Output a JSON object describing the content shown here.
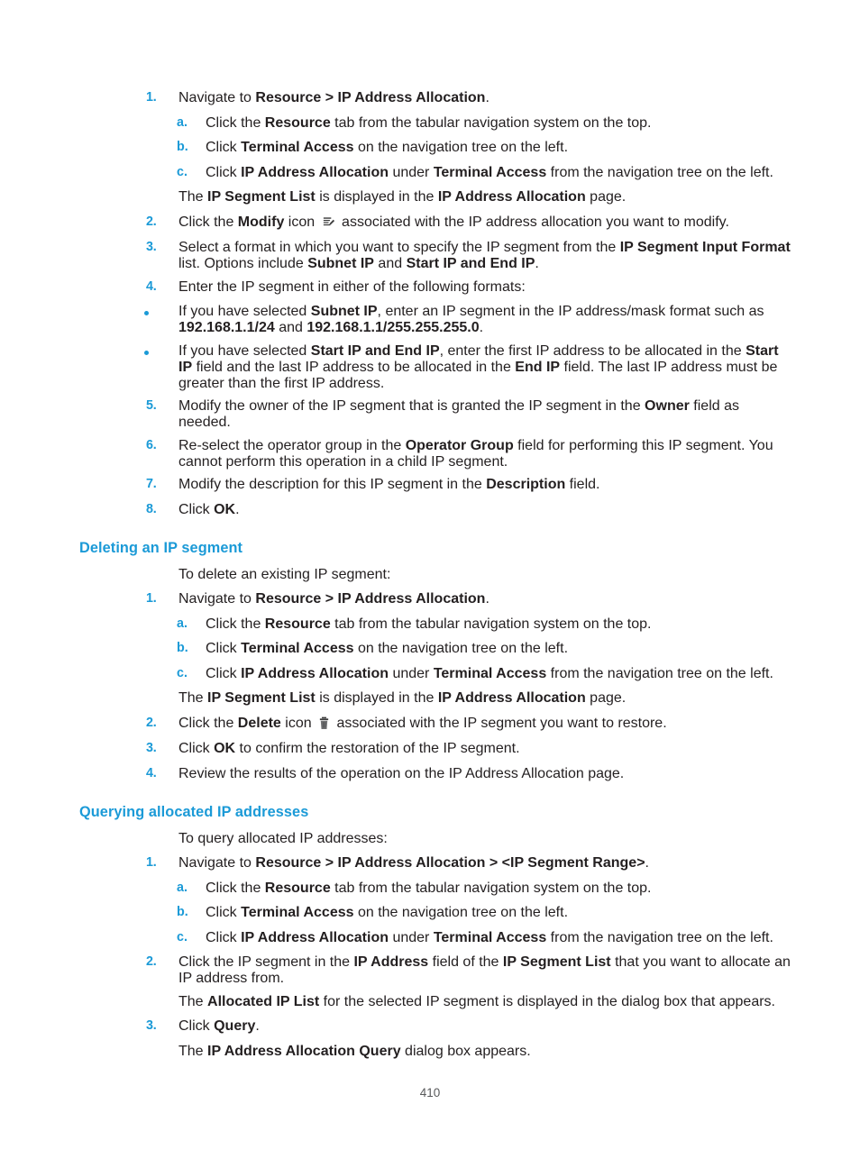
{
  "document": {
    "page_number": "410",
    "accent_color": "#1b9ad7",
    "text_color": "#231f20"
  },
  "sections": [
    {
      "id": "modify-steps",
      "heading": null,
      "items": [
        {
          "type": "numbered",
          "marker": "1.",
          "parts": [
            {
              "t": "Navigate to ",
              "b": false
            },
            {
              "t": "Resource > IP Address Allocation",
              "b": true
            },
            {
              "t": ".",
              "b": false
            }
          ]
        },
        {
          "type": "lettered",
          "marker": "a.",
          "parts": [
            {
              "t": "Click the ",
              "b": false
            },
            {
              "t": "Resource",
              "b": true
            },
            {
              "t": " tab from the tabular navigation system on the top.",
              "b": false
            }
          ]
        },
        {
          "type": "lettered",
          "marker": "b.",
          "parts": [
            {
              "t": "Click ",
              "b": false
            },
            {
              "t": "Terminal Access",
              "b": true
            },
            {
              "t": " on the navigation tree on the left.",
              "b": false
            }
          ]
        },
        {
          "type": "lettered",
          "marker": "c.",
          "parts": [
            {
              "t": "Click ",
              "b": false
            },
            {
              "t": "IP Address Allocation",
              "b": true
            },
            {
              "t": " under ",
              "b": false
            },
            {
              "t": "Terminal Access",
              "b": true
            },
            {
              "t": " from the navigation tree on the left.",
              "b": false
            }
          ]
        },
        {
          "type": "continuation-sub",
          "parts": [
            {
              "t": "The ",
              "b": false
            },
            {
              "t": "IP Segment List",
              "b": true
            },
            {
              "t": " is displayed in the ",
              "b": false
            },
            {
              "t": "IP Address Allocation",
              "b": true
            },
            {
              "t": " page.",
              "b": false
            }
          ]
        },
        {
          "type": "numbered",
          "marker": "2.",
          "icon": "modify-icon",
          "parts": [
            {
              "t": "Click the ",
              "b": false
            },
            {
              "t": "Modify",
              "b": true
            },
            {
              "t": " icon ",
              "b": false
            },
            {
              "t": "@ICON@",
              "b": false
            },
            {
              "t": " associated with the IP address allocation you want to modify.",
              "b": false
            }
          ]
        },
        {
          "type": "numbered",
          "marker": "3.",
          "parts": [
            {
              "t": "Select a format in which you want to specify the IP segment from the ",
              "b": false
            },
            {
              "t": "IP Segment Input Format",
              "b": true
            },
            {
              "t": " list. Options include ",
              "b": false
            },
            {
              "t": "Subnet IP",
              "b": true
            },
            {
              "t": " and ",
              "b": false
            },
            {
              "t": "Start IP and End IP",
              "b": true
            },
            {
              "t": ".",
              "b": false
            }
          ]
        },
        {
          "type": "numbered",
          "marker": "4.",
          "parts": [
            {
              "t": "Enter the IP segment in either of the following formats:",
              "b": false
            }
          ]
        },
        {
          "type": "bullet",
          "parts": [
            {
              "t": "If you have selected ",
              "b": false
            },
            {
              "t": "Subnet IP",
              "b": true
            },
            {
              "t": ", enter an IP segment in the IP address/mask format such as ",
              "b": false
            },
            {
              "t": "192.168.1.1/24",
              "b": true
            },
            {
              "t": " and ",
              "b": false
            },
            {
              "t": "192.168.1.1/255.255.255.0",
              "b": true
            },
            {
              "t": ".",
              "b": false
            }
          ]
        },
        {
          "type": "bullet",
          "parts": [
            {
              "t": "If you have selected ",
              "b": false
            },
            {
              "t": "Start IP and End IP",
              "b": true
            },
            {
              "t": ", enter the first IP address to be allocated in the ",
              "b": false
            },
            {
              "t": "Start IP",
              "b": true
            },
            {
              "t": " field and the last IP address to be allocated in the ",
              "b": false
            },
            {
              "t": "End IP",
              "b": true
            },
            {
              "t": " field. The last IP address must be greater than the first IP address.",
              "b": false
            }
          ]
        },
        {
          "type": "numbered",
          "marker": "5.",
          "parts": [
            {
              "t": "Modify the owner of the IP segment that is granted the IP segment in the ",
              "b": false
            },
            {
              "t": "Owner",
              "b": true
            },
            {
              "t": " field as needed.",
              "b": false
            }
          ]
        },
        {
          "type": "numbered",
          "marker": "6.",
          "parts": [
            {
              "t": "Re-select the operator group in the ",
              "b": false
            },
            {
              "t": "Operator Group",
              "b": true
            },
            {
              "t": " field for performing this IP segment. You cannot perform this operation in a child IP segment.",
              "b": false
            }
          ]
        },
        {
          "type": "numbered",
          "marker": "7.",
          "parts": [
            {
              "t": "Modify the description for this IP segment in the ",
              "b": false
            },
            {
              "t": "Description",
              "b": true
            },
            {
              "t": " field.",
              "b": false
            }
          ]
        },
        {
          "type": "numbered",
          "marker": "8.",
          "parts": [
            {
              "t": "Click ",
              "b": false
            },
            {
              "t": "OK",
              "b": true
            },
            {
              "t": ".",
              "b": false
            }
          ]
        }
      ]
    },
    {
      "id": "deleting-ip-segment",
      "heading": "Deleting an IP segment",
      "items": [
        {
          "type": "continuation",
          "parts": [
            {
              "t": "To delete an existing IP segment:",
              "b": false
            }
          ]
        },
        {
          "type": "numbered",
          "marker": "1.",
          "parts": [
            {
              "t": "Navigate to ",
              "b": false
            },
            {
              "t": "Resource > IP Address Allocation",
              "b": true
            },
            {
              "t": ".",
              "b": false
            }
          ]
        },
        {
          "type": "lettered",
          "marker": "a.",
          "parts": [
            {
              "t": "Click the ",
              "b": false
            },
            {
              "t": "Resource",
              "b": true
            },
            {
              "t": " tab from the tabular navigation system on the top.",
              "b": false
            }
          ]
        },
        {
          "type": "lettered",
          "marker": "b.",
          "parts": [
            {
              "t": "Click ",
              "b": false
            },
            {
              "t": "Terminal Access",
              "b": true
            },
            {
              "t": " on the navigation tree on the left.",
              "b": false
            }
          ]
        },
        {
          "type": "lettered",
          "marker": "c.",
          "parts": [
            {
              "t": "Click ",
              "b": false
            },
            {
              "t": "IP Address Allocation",
              "b": true
            },
            {
              "t": " under ",
              "b": false
            },
            {
              "t": "Terminal Access",
              "b": true
            },
            {
              "t": " from the navigation tree on the left.",
              "b": false
            }
          ]
        },
        {
          "type": "continuation-sub",
          "parts": [
            {
              "t": "The ",
              "b": false
            },
            {
              "t": "IP Segment List",
              "b": true
            },
            {
              "t": " is displayed in the ",
              "b": false
            },
            {
              "t": "IP Address Allocation",
              "b": true
            },
            {
              "t": " page.",
              "b": false
            }
          ]
        },
        {
          "type": "numbered",
          "marker": "2.",
          "icon": "delete-icon",
          "parts": [
            {
              "t": "Click the ",
              "b": false
            },
            {
              "t": "Delete",
              "b": true
            },
            {
              "t": " icon ",
              "b": false
            },
            {
              "t": "@ICON@",
              "b": false
            },
            {
              "t": " associated with the IP segment you want to restore.",
              "b": false
            }
          ]
        },
        {
          "type": "numbered",
          "marker": "3.",
          "parts": [
            {
              "t": "Click ",
              "b": false
            },
            {
              "t": "OK",
              "b": true
            },
            {
              "t": " to confirm the restoration of the IP segment.",
              "b": false
            }
          ]
        },
        {
          "type": "numbered",
          "marker": "4.",
          "parts": [
            {
              "t": "Review the results of the operation on the IP Address Allocation page.",
              "b": false
            }
          ]
        }
      ]
    },
    {
      "id": "querying-allocated-ip-addresses",
      "heading": "Querying allocated IP addresses",
      "items": [
        {
          "type": "continuation",
          "parts": [
            {
              "t": "To query allocated IP addresses:",
              "b": false
            }
          ]
        },
        {
          "type": "numbered",
          "marker": "1.",
          "parts": [
            {
              "t": "Navigate to ",
              "b": false
            },
            {
              "t": "Resource > IP Address Allocation > <IP Segment Range>",
              "b": true
            },
            {
              "t": ".",
              "b": false
            }
          ]
        },
        {
          "type": "lettered",
          "marker": "a.",
          "parts": [
            {
              "t": "Click the ",
              "b": false
            },
            {
              "t": "Resource",
              "b": true
            },
            {
              "t": " tab from the tabular navigation system on the top.",
              "b": false
            }
          ]
        },
        {
          "type": "lettered",
          "marker": "b.",
          "parts": [
            {
              "t": "Click ",
              "b": false
            },
            {
              "t": "Terminal Access",
              "b": true
            },
            {
              "t": " on the navigation tree on the left.",
              "b": false
            }
          ]
        },
        {
          "type": "lettered",
          "marker": "c.",
          "parts": [
            {
              "t": "Click ",
              "b": false
            },
            {
              "t": "IP Address Allocation",
              "b": true
            },
            {
              "t": " under ",
              "b": false
            },
            {
              "t": "Terminal Access",
              "b": true
            },
            {
              "t": " from the navigation tree on the left.",
              "b": false
            }
          ]
        },
        {
          "type": "numbered",
          "marker": "2.",
          "parts": [
            {
              "t": "Click the IP segment in the ",
              "b": false
            },
            {
              "t": "IP Address",
              "b": true
            },
            {
              "t": " field of the ",
              "b": false
            },
            {
              "t": "IP Segment List",
              "b": true
            },
            {
              "t": " that you want to allocate an IP address from.",
              "b": false
            }
          ]
        },
        {
          "type": "continuation-sub",
          "parts": [
            {
              "t": "The ",
              "b": false
            },
            {
              "t": "Allocated IP List",
              "b": true
            },
            {
              "t": " for the selected IP segment is displayed in the dialog box that appears.",
              "b": false
            }
          ]
        },
        {
          "type": "numbered",
          "marker": "3.",
          "parts": [
            {
              "t": "Click ",
              "b": false
            },
            {
              "t": "Query",
              "b": true
            },
            {
              "t": ".",
              "b": false
            }
          ]
        },
        {
          "type": "continuation-sub",
          "parts": [
            {
              "t": "The ",
              "b": false
            },
            {
              "t": "IP Address Allocation Query",
              "b": true
            },
            {
              "t": " dialog box appears.",
              "b": false
            }
          ]
        }
      ]
    }
  ]
}
